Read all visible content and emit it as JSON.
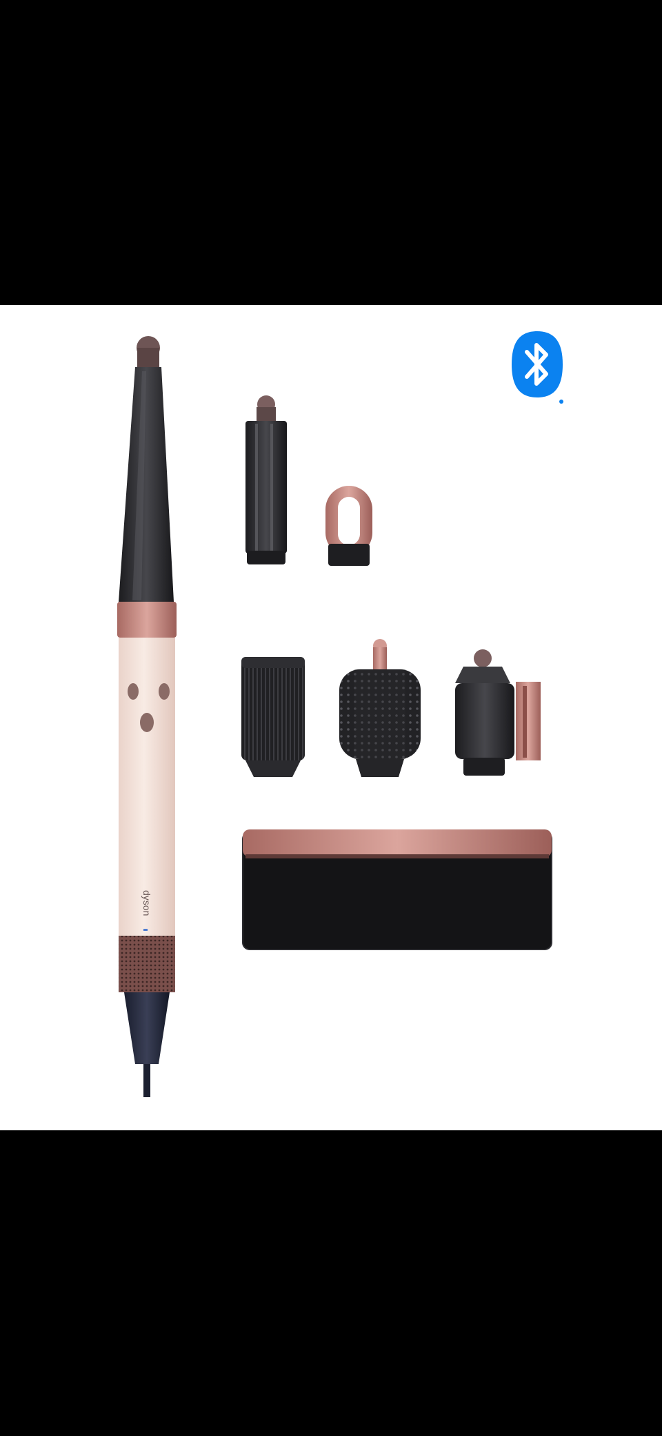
{
  "product_photo": {
    "brand_text": "dyson",
    "bluetooth_badge": "bluetooth-icon",
    "colors": {
      "background": "#ffffff",
      "letterbox": "#000000",
      "rose_gold": "#c9918a",
      "ceramic_pink": "#f5e4dc",
      "barrel_dark": "#2b2b2e",
      "bluetooth_blue": "#0b82f0"
    },
    "items": [
      "airwrap-styler",
      "long-barrel-attachment",
      "pre-styling-dryer-attachment",
      "firm-smoothing-brush",
      "round-volumizing-brush",
      "coanda-smoothing-dryer",
      "storage-case"
    ]
  }
}
